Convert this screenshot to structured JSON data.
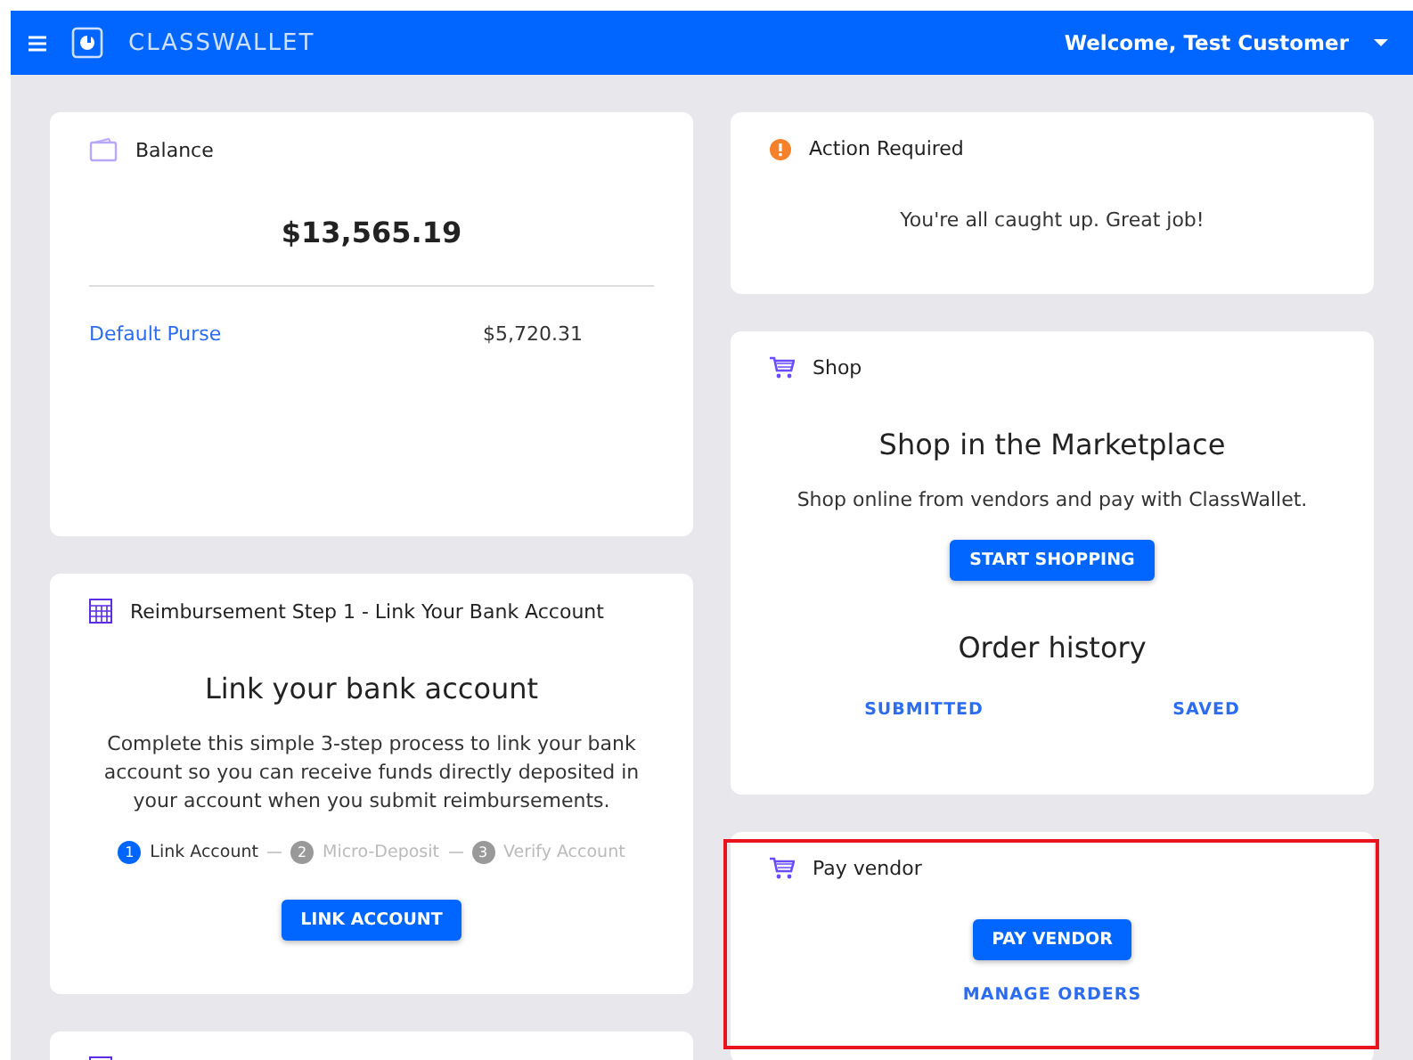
{
  "header": {
    "brand": "CLASSWALLET",
    "welcome": "Welcome, Test Customer"
  },
  "left": [
    {
      "kind": "balance",
      "title": "Balance",
      "total": "$13,565.19",
      "purses": [
        {
          "name": "Default Purse",
          "amount": "$5,720.31"
        }
      ]
    },
    {
      "kind": "link",
      "title": "Reimbursement Step 1 - Link Your Bank Account",
      "heading": "Link your bank account",
      "text": "Complete this simple 3-step process to link your bank account so you can receive funds directly deposited in your account when you submit reimbursements.",
      "steps": [
        {
          "number": "1",
          "label": "Link Account",
          "selected": true
        },
        {
          "number": "2",
          "label": "Micro-Deposit",
          "selected": false
        },
        {
          "number": "3",
          "label": "Verify Account",
          "selected": false
        }
      ],
      "button": "LINK ACCOUNT"
    },
    {
      "kind": "stub"
    }
  ],
  "right": [
    {
      "kind": "action",
      "title": "Action Required",
      "text": "You're all caught up. Great job!"
    },
    {
      "kind": "shop",
      "title": "Shop",
      "heading": "Shop in the Marketplace",
      "text": "Shop online from vendors and pay with ClassWallet.",
      "button": "START SHOPPING",
      "history": "Order history",
      "links": [
        "SUBMITTED",
        "SAVED"
      ]
    },
    {
      "kind": "pay",
      "title": "Pay vendor",
      "button": "PAY VENDOR",
      "link": "MANAGE ORDERS",
      "highlighted": true
    }
  ]
}
